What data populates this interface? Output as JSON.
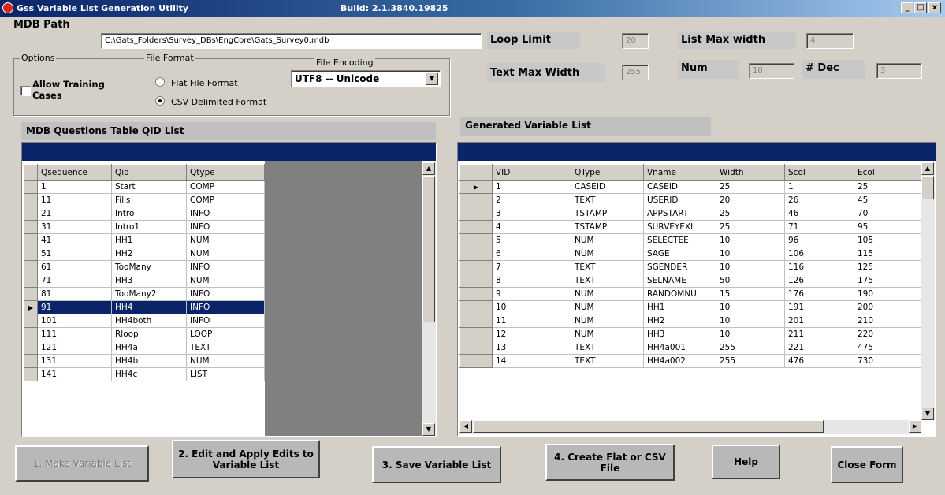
{
  "window": {
    "title": "Gss Variable List Generation Utility",
    "build": "Build: 2.1.3840.19825",
    "min_label": "_",
    "max_label": "□",
    "close_label": "x"
  },
  "mdb": {
    "label": "MDB Path",
    "path": "C:\\Gats_Folders\\Survey_DBs\\EngCore\\Gats_Survey0.mdb"
  },
  "options": {
    "legend": "Options",
    "allow_training_label": "Allow Training Cases"
  },
  "file_format": {
    "legend": "File Format",
    "flat_label": "Flat File Format",
    "csv_label": "CSV Delimited  Format",
    "selected": "csv"
  },
  "file_encoding": {
    "legend": "File Encoding",
    "value": "UTF8 -- Unicode"
  },
  "settings": {
    "loop_limit_label": "Loop Limit",
    "loop_limit_value": "20",
    "list_max_width_label": "List Max width",
    "list_max_width_value": "4",
    "text_max_width_label": "Text Max Width",
    "text_max_width_value": "255",
    "num_label": "Num",
    "num_value": "10",
    "dec_label": "# Dec",
    "dec_value": "3"
  },
  "qid_table": {
    "title": "MDB Questions Table QID List",
    "columns": [
      "Qsequence",
      "Qid",
      "Qtype"
    ],
    "selected_row": 9,
    "rows": [
      [
        "1",
        "Start",
        "COMP"
      ],
      [
        "11",
        "Fills",
        "COMP"
      ],
      [
        "21",
        "Intro",
        "INFO"
      ],
      [
        "31",
        "Intro1",
        "INFO"
      ],
      [
        "41",
        "HH1",
        "NUM"
      ],
      [
        "51",
        "HH2",
        "NUM"
      ],
      [
        "61",
        "TooMany",
        "INFO"
      ],
      [
        "71",
        "HH3",
        "NUM"
      ],
      [
        "81",
        "TooMany2",
        "INFO"
      ],
      [
        "91",
        "HH4",
        "INFO"
      ],
      [
        "101",
        "HH4both",
        "INFO"
      ],
      [
        "111",
        "Rloop",
        "LOOP"
      ],
      [
        "121",
        "HH4a",
        "TEXT"
      ],
      [
        "131",
        "HH4b",
        "NUM"
      ],
      [
        "141",
        "HH4c",
        "LIST"
      ]
    ]
  },
  "var_table": {
    "title": "Generated Variable List",
    "columns": [
      "VID",
      "QType",
      "Vname",
      "Width",
      "Scol",
      "Ecol"
    ],
    "current_row": 0,
    "rows": [
      [
        "1",
        "CASEID",
        "CASEID",
        "25",
        "1",
        "25"
      ],
      [
        "2",
        "TEXT",
        "USERID",
        "20",
        "26",
        "45"
      ],
      [
        "3",
        "TSTAMP",
        "APPSTART",
        "25",
        "46",
        "70"
      ],
      [
        "4",
        "TSTAMP",
        "SURVEYEXI",
        "25",
        "71",
        "95"
      ],
      [
        "5",
        "NUM",
        "SELECTEE",
        "10",
        "96",
        "105"
      ],
      [
        "6",
        "NUM",
        "SAGE",
        "10",
        "106",
        "115"
      ],
      [
        "7",
        "TEXT",
        "SGENDER",
        "10",
        "116",
        "125"
      ],
      [
        "8",
        "TEXT",
        "SELNAME",
        "50",
        "126",
        "175"
      ],
      [
        "9",
        "NUM",
        "RANDOMNU",
        "15",
        "176",
        "190"
      ],
      [
        "10",
        "NUM",
        "HH1",
        "10",
        "191",
        "200"
      ],
      [
        "11",
        "NUM",
        "HH2",
        "10",
        "201",
        "210"
      ],
      [
        "12",
        "NUM",
        "HH3",
        "10",
        "211",
        "220"
      ],
      [
        "13",
        "TEXT",
        "HH4a001",
        "255",
        "221",
        "475"
      ],
      [
        "14",
        "TEXT",
        "HH4a002",
        "255",
        "476",
        "730"
      ]
    ]
  },
  "buttons": {
    "make": "1. Make Variable List",
    "edit": "2. Edit and Apply Edits to Variable List",
    "save": "3. Save Variable List",
    "create": "4. Create Flat or CSV File",
    "help": "Help",
    "close": "Close Form"
  }
}
